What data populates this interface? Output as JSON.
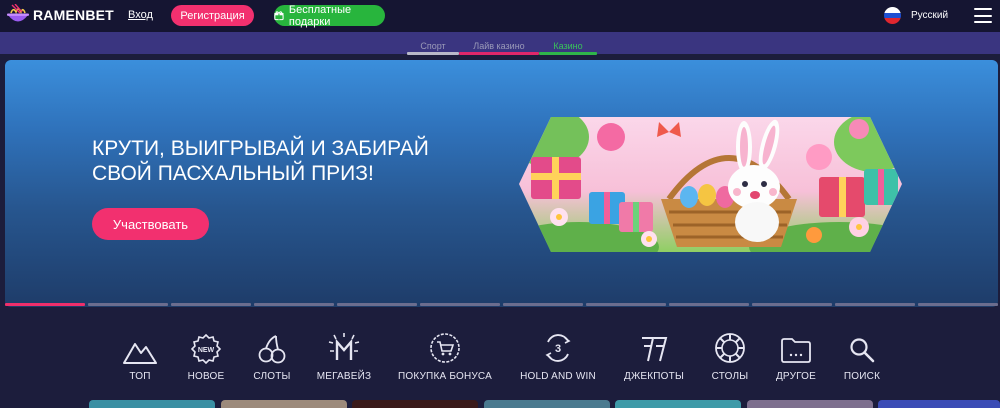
{
  "header": {
    "brand": "RAMENBET",
    "login_label": "Вход",
    "register_label": "Регистрация",
    "gifts_label": "Бесплатные подарки",
    "language": "Русский"
  },
  "tabs": [
    {
      "label": "Спорт",
      "color": "#b9b9c9"
    },
    {
      "label": "Лайв казино",
      "color": "#e0276a"
    },
    {
      "label": "Казино",
      "color": "#2fb44a",
      "active": true
    }
  ],
  "hero": {
    "title_line1": "Крути, выигрывай и забирай",
    "title_line2": "свой пасхальный приз!",
    "cta_label": "Участвовать",
    "slides_total": 12,
    "active_slide": 1
  },
  "categories": [
    {
      "label": "ТОП",
      "icon": "mountain-icon"
    },
    {
      "label": "НОВОЕ",
      "icon": "new-badge-icon"
    },
    {
      "label": "СЛОТЫ",
      "icon": "cherry-icon"
    },
    {
      "label": "МЕГАВЕЙЗ",
      "icon": "megaways-icon"
    },
    {
      "label": "ПОКУПКА БОНУСА",
      "icon": "cart-badge-icon"
    },
    {
      "label": "HOLD AND WIN",
      "icon": "hold-and-win-icon"
    },
    {
      "label": "ДЖЕКПОТЫ",
      "icon": "sevens-icon"
    },
    {
      "label": "СТОЛЫ",
      "icon": "chip-icon"
    },
    {
      "label": "ДРУГОЕ",
      "icon": "folder-icon"
    },
    {
      "label": "ПОИСК",
      "icon": "search-icon"
    }
  ],
  "colors": {
    "accent_pink": "#f2306f",
    "accent_green": "#28b53d",
    "background": "#1c1d3c",
    "header": "#151532",
    "tabbar": "#3a3580"
  }
}
